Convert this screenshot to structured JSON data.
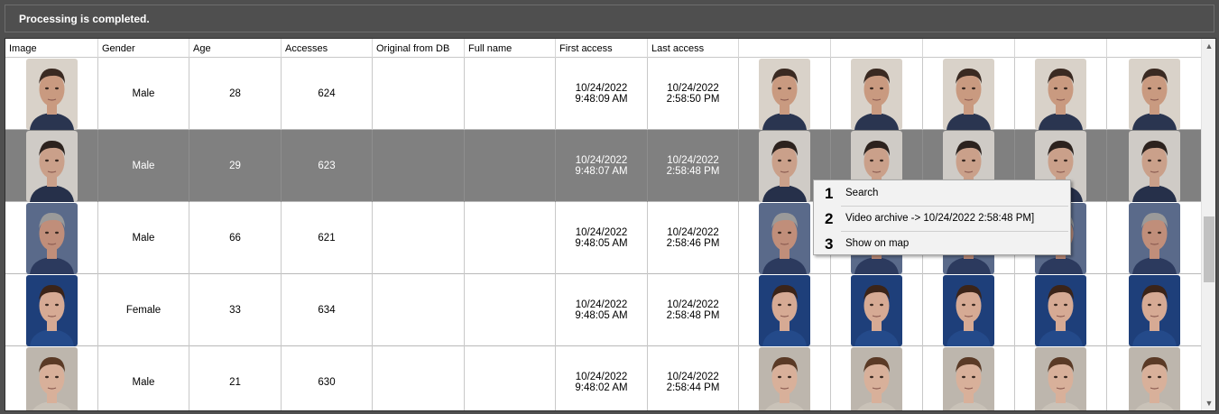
{
  "status": {
    "message": "Processing is completed."
  },
  "grid": {
    "columns": [
      "Image",
      "Gender",
      "Age",
      "Accesses",
      "Original from DB",
      "Full name",
      "First access",
      "Last access",
      "",
      "",
      "",
      "",
      ""
    ],
    "rows": [
      {
        "gender": "Male",
        "age": "28",
        "accesses": "624",
        "original": "",
        "full_name": "",
        "first_access": [
          "10/24/2022",
          "9:48:09 AM"
        ],
        "last_access": [
          "10/24/2022",
          "2:58:50 PM"
        ],
        "selected": false
      },
      {
        "gender": "Male",
        "age": "29",
        "accesses": "623",
        "original": "",
        "full_name": "",
        "first_access": [
          "10/24/2022",
          "9:48:07 AM"
        ],
        "last_access": [
          "10/24/2022",
          "2:58:48 PM"
        ],
        "selected": true
      },
      {
        "gender": "Male",
        "age": "66",
        "accesses": "621",
        "original": "",
        "full_name": "",
        "first_access": [
          "10/24/2022",
          "9:48:05 AM"
        ],
        "last_access": [
          "10/24/2022",
          "2:58:46 PM"
        ],
        "selected": false
      },
      {
        "gender": "Female",
        "age": "33",
        "accesses": "634",
        "original": "",
        "full_name": "",
        "first_access": [
          "10/24/2022",
          "9:48:05 AM"
        ],
        "last_access": [
          "10/24/2022",
          "2:58:48 PM"
        ],
        "selected": false
      },
      {
        "gender": "Male",
        "age": "21",
        "accesses": "630",
        "original": "",
        "full_name": "",
        "first_access": [
          "10/24/2022",
          "9:48:02 AM"
        ],
        "last_access": [
          "10/24/2022",
          "2:58:44 PM"
        ],
        "selected": false
      }
    ],
    "selected_row_color": "#808080"
  },
  "context_menu": {
    "items": [
      {
        "number": "1",
        "label": "Search"
      },
      {
        "number": "2",
        "label": "Video archive -> 10/24/2022 2:58:48 PM]"
      },
      {
        "number": "3",
        "label": "Show on map"
      }
    ]
  },
  "scrollbar": {
    "up_icon": "chevron-up-icon",
    "down_icon": "chevron-down-icon"
  }
}
